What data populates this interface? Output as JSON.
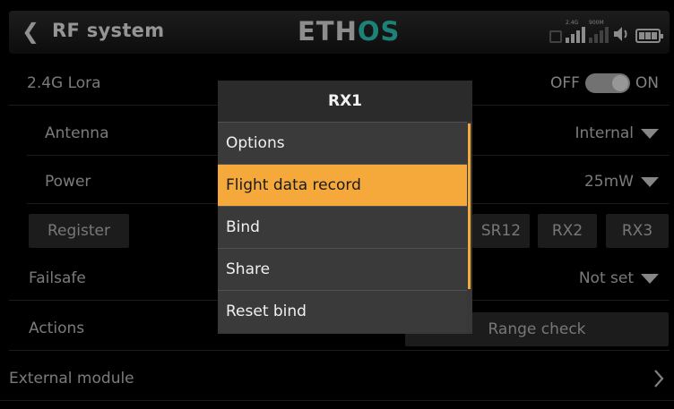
{
  "header": {
    "title": "RF system",
    "logo_part1": "ETH",
    "logo_part2": "OS",
    "signal_tag_1": "2.4G",
    "signal_tag_2": "900M"
  },
  "rows": {
    "lora": {
      "label": "2.4G Lora",
      "toggle_off": "OFF",
      "toggle_on": "ON",
      "state": "on"
    },
    "antenna": {
      "label": "Antenna",
      "value": "Internal"
    },
    "power": {
      "label": "Power",
      "value": "25mW"
    },
    "register": {
      "button": "Register",
      "rx_buttons": [
        "SR12",
        "RX2",
        "RX3"
      ]
    },
    "failsafe": {
      "label": "Failsafe",
      "value": "Not set"
    },
    "actions": {
      "label": "Actions",
      "button": "Range check"
    },
    "external": {
      "label": "External module"
    }
  },
  "dialog": {
    "title": "RX1",
    "items": [
      {
        "label": "Options"
      },
      {
        "label": "Flight data record",
        "selected": true
      },
      {
        "label": "Bind"
      },
      {
        "label": "Share"
      },
      {
        "label": "Reset bind"
      }
    ]
  },
  "colors": {
    "accent": "#f6a93b",
    "logo_accent": "#2fd0c2",
    "background": "#000000"
  }
}
